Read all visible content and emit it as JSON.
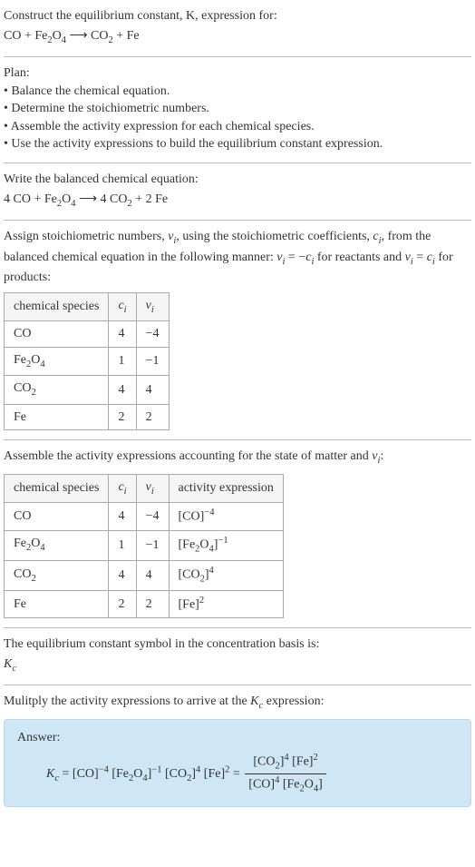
{
  "header": {
    "prompt": "Construct the equilibrium constant, K, expression for:",
    "equation_html": "CO + Fe<sub>2</sub>O<sub>4</sub> ⟶ CO<sub>2</sub> + Fe"
  },
  "plan": {
    "title": "Plan:",
    "bullets": [
      "• Balance the chemical equation.",
      "• Determine the stoichiometric numbers.",
      "• Assemble the activity expression for each chemical species.",
      "• Use the activity expressions to build the equilibrium constant expression."
    ]
  },
  "balanced": {
    "prompt": "Write the balanced chemical equation:",
    "equation_html": "4 CO + Fe<sub>2</sub>O<sub>4</sub> ⟶ 4 CO<sub>2</sub> + 2 Fe"
  },
  "stoich": {
    "prompt_html": "Assign stoichiometric numbers, <span class=\"italic\">ν<sub>i</sub></span>, using the stoichiometric coefficients, <span class=\"italic\">c<sub>i</sub></span>, from the balanced chemical equation in the following manner: <span class=\"italic\">ν<sub>i</sub></span> = −<span class=\"italic\">c<sub>i</sub></span> for reactants and <span class=\"italic\">ν<sub>i</sub></span> = <span class=\"italic\">c<sub>i</sub></span> for products:",
    "headers": {
      "species": "chemical species",
      "ci_html": "<span class=\"italic\">c<sub>i</sub></span>",
      "vi_html": "<span class=\"italic\">ν<sub>i</sub></span>"
    },
    "rows": [
      {
        "species_html": "CO",
        "ci": "4",
        "vi": "−4"
      },
      {
        "species_html": "Fe<sub>2</sub>O<sub>4</sub>",
        "ci": "1",
        "vi": "−1"
      },
      {
        "species_html": "CO<sub>2</sub>",
        "ci": "4",
        "vi": "4"
      },
      {
        "species_html": "Fe",
        "ci": "2",
        "vi": "2"
      }
    ]
  },
  "activity": {
    "prompt_html": "Assemble the activity expressions accounting for the state of matter and <span class=\"italic\">ν<sub>i</sub></span>:",
    "headers": {
      "species": "chemical species",
      "ci_html": "<span class=\"italic\">c<sub>i</sub></span>",
      "vi_html": "<span class=\"italic\">ν<sub>i</sub></span>",
      "activity": "activity expression"
    },
    "rows": [
      {
        "species_html": "CO",
        "ci": "4",
        "vi": "−4",
        "activity_html": "[CO]<sup>−4</sup>"
      },
      {
        "species_html": "Fe<sub>2</sub>O<sub>4</sub>",
        "ci": "1",
        "vi": "−1",
        "activity_html": "[Fe<sub>2</sub>O<sub>4</sub>]<sup>−1</sup>"
      },
      {
        "species_html": "CO<sub>2</sub>",
        "ci": "4",
        "vi": "4",
        "activity_html": "[CO<sub>2</sub>]<sup>4</sup>"
      },
      {
        "species_html": "Fe",
        "ci": "2",
        "vi": "2",
        "activity_html": "[Fe]<sup>2</sup>"
      }
    ]
  },
  "symbol": {
    "prompt": "The equilibrium constant symbol in the concentration basis is:",
    "value_html": "<span class=\"italic\">K<sub>c</sub></span>"
  },
  "multiply": {
    "prompt_html": "Mulitply the activity expressions to arrive at the <span class=\"italic\">K<sub>c</sub></span> expression:"
  },
  "answer": {
    "label": "Answer:",
    "lhs_html": "<span class=\"italic\">K<sub>c</sub></span> = [CO]<sup>−4</sup> [Fe<sub>2</sub>O<sub>4</sub>]<sup>−1</sup> [CO<sub>2</sub>]<sup>4</sup> [Fe]<sup>2</sup> = ",
    "frac_num_html": "[CO<sub>2</sub>]<sup>4</sup> [Fe]<sup>2</sup>",
    "frac_den_html": "[CO]<sup>4</sup> [Fe<sub>2</sub>O<sub>4</sub>]"
  },
  "chart_data": {
    "type": "table",
    "tables": [
      {
        "title": "Stoichiometric numbers",
        "columns": [
          "chemical species",
          "c_i",
          "ν_i"
        ],
        "rows": [
          [
            "CO",
            4,
            -4
          ],
          [
            "Fe2O4",
            1,
            -1
          ],
          [
            "CO2",
            4,
            4
          ],
          [
            "Fe",
            2,
            2
          ]
        ]
      },
      {
        "title": "Activity expressions",
        "columns": [
          "chemical species",
          "c_i",
          "ν_i",
          "activity expression"
        ],
        "rows": [
          [
            "CO",
            4,
            -4,
            "[CO]^-4"
          ],
          [
            "Fe2O4",
            1,
            -1,
            "[Fe2O4]^-1"
          ],
          [
            "CO2",
            4,
            4,
            "[CO2]^4"
          ],
          [
            "Fe",
            2,
            2,
            "[Fe]^2"
          ]
        ]
      }
    ]
  }
}
